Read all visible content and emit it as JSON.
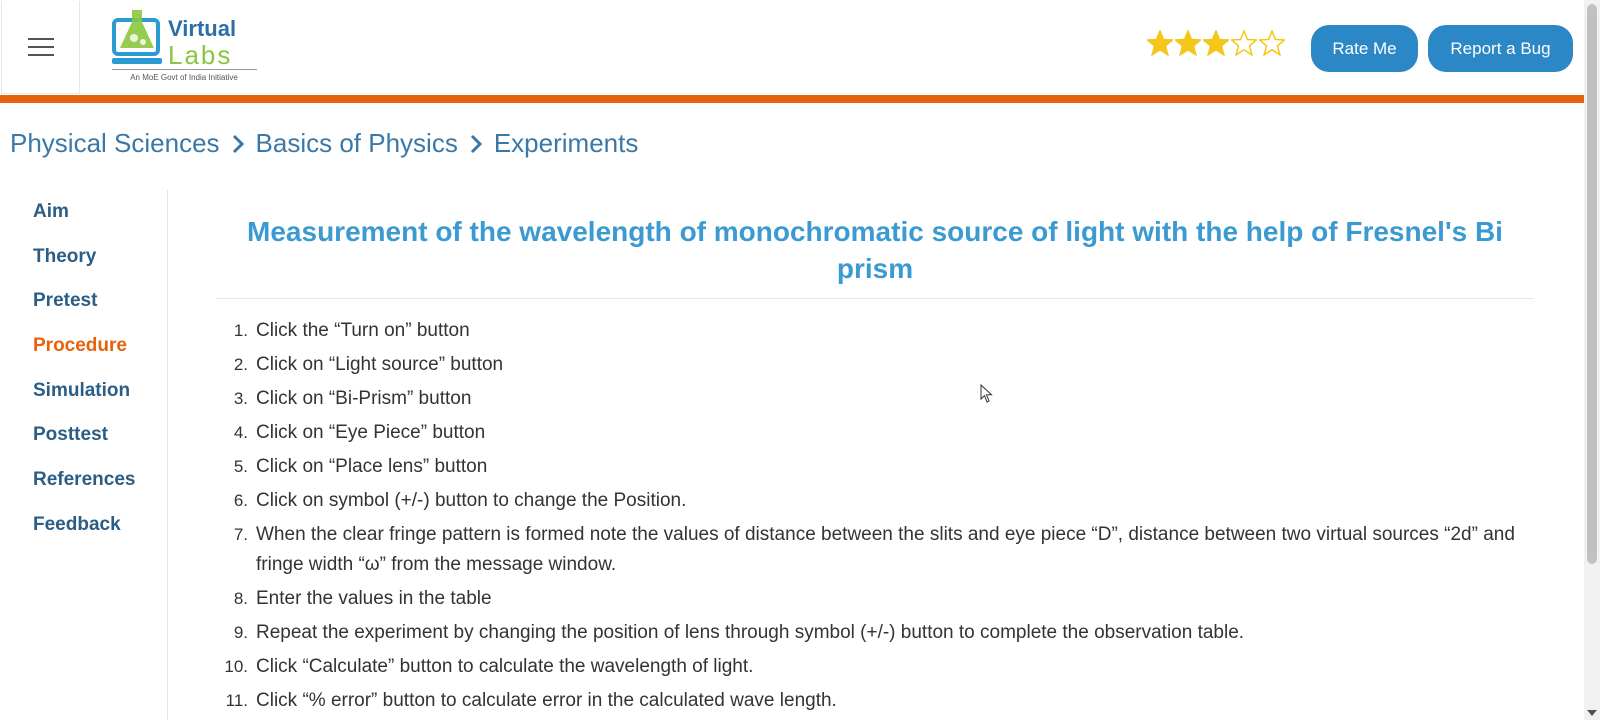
{
  "header": {
    "logo_text_top": "Virtual",
    "logo_text_bottom": "Labs",
    "logo_tagline": "An MoE Govt of India Initiative",
    "rating": {
      "value": 3,
      "max": 5
    },
    "rate_button": "Rate Me",
    "bug_button": "Report a Bug"
  },
  "colors": {
    "accent_orange": "#e8620c",
    "button_blue": "#2b87c6",
    "title_blue": "#3b9ad1",
    "nav_blue": "#2b5d85",
    "star_gold": "#f5c518"
  },
  "breadcrumb": [
    "Physical Sciences",
    "Basics of Physics",
    "Experiments"
  ],
  "sidebar": {
    "items": [
      {
        "label": "Aim",
        "active": false
      },
      {
        "label": "Theory",
        "active": false
      },
      {
        "label": "Pretest",
        "active": false
      },
      {
        "label": "Procedure",
        "active": true
      },
      {
        "label": "Simulation",
        "active": false
      },
      {
        "label": "Posttest",
        "active": false
      },
      {
        "label": "References",
        "active": false
      },
      {
        "label": "Feedback",
        "active": false
      }
    ]
  },
  "main": {
    "title": "Measurement of the wavelength of monochromatic source of light with the help of Fresnel's Bi prism",
    "steps": [
      {
        "num": "1.",
        "text": "Click the “Turn on” button"
      },
      {
        "num": "2.",
        "text": "Click on “Light source” button"
      },
      {
        "num": "3.",
        "text": "Click on “Bi-Prism” button"
      },
      {
        "num": "4.",
        "text": "Click on “Eye Piece” button"
      },
      {
        "num": "5.",
        "text": "Click on “Place lens” button"
      },
      {
        "num": "6.",
        "text": "Click on symbol (+/-) button to change the Position."
      },
      {
        "num": "7.",
        "text": "When the clear fringe pattern is formed note the values of distance between the slits and eye piece “D”, distance between two virtual sources “2d” and fringe width “ω” from the message window."
      },
      {
        "num": "8.",
        "text": "Enter the values in the table"
      },
      {
        "num": "9.",
        "text": "Repeat the experiment by changing the position of lens through symbol (+/-) button to complete the observation table."
      },
      {
        "num": "10.",
        "text": "Click “Calculate” button to calculate the wavelength of light."
      },
      {
        "num": "11.",
        "text": "Click “% error” button to calculate error in the calculated wave length."
      }
    ]
  }
}
